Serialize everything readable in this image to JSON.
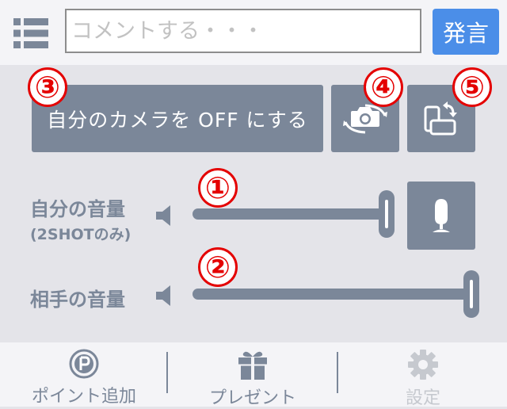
{
  "header": {
    "comment_placeholder": "コメントする・・・",
    "send_label": "発言"
  },
  "controls": {
    "camera_off_label": "自分のカメラを OFF にする",
    "badges": [
      "③",
      "④",
      "⑤",
      "①",
      "②"
    ],
    "my_volume": {
      "label": "自分の音量",
      "sublabel": "(2SHOTのみ)",
      "level": 0.98
    },
    "partner_volume": {
      "label": "相手の音量",
      "level": 1.0
    }
  },
  "icons": {
    "menu": "list-icon",
    "switch_camera": "camera-switch-icon",
    "rotate": "screen-rotate-icon",
    "mic": "microphone-icon",
    "speaker": "speaker-icon",
    "points": "p-coin-icon",
    "present": "gift-icon",
    "settings": "gear-icon"
  },
  "colors": {
    "accent": "#4b8ee8",
    "control": "#7b8799",
    "badge": "#e40000",
    "disabled": "#c6c9cf"
  },
  "tabs": [
    {
      "label": "ポイント追加",
      "enabled": true
    },
    {
      "label": "プレゼント",
      "enabled": true
    },
    {
      "label": "設定",
      "enabled": false
    }
  ]
}
